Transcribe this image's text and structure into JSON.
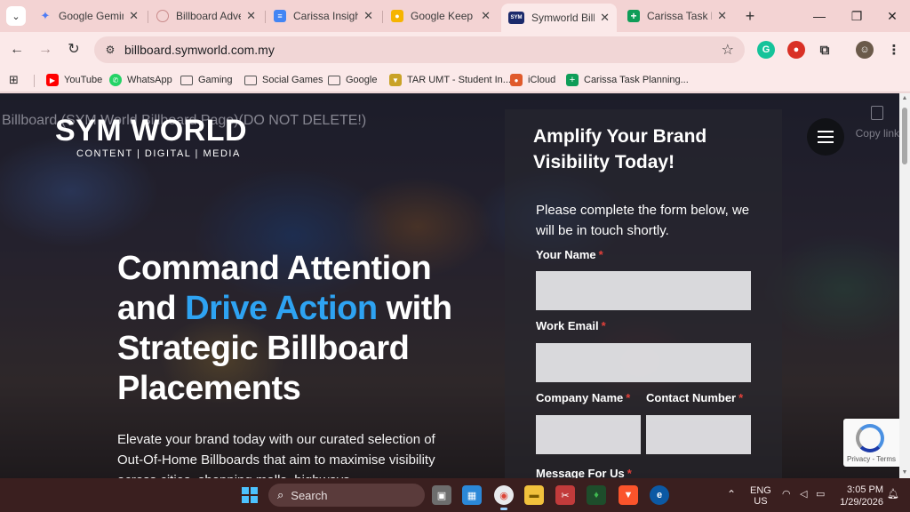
{
  "browser": {
    "tabs": [
      {
        "title": "Google Gemini",
        "favicon": "gemini-icon",
        "color": "#4e7cf5",
        "glyph": "✦"
      },
      {
        "title": "Billboard Advert",
        "favicon": "billboard-icon",
        "color": "#c98a8a",
        "glyph": "◉"
      },
      {
        "title": "Carissa Insight E",
        "favicon": "docs-icon",
        "color": "#4285f4",
        "glyph": "≡"
      },
      {
        "title": "Google Keep",
        "favicon": "keep-icon",
        "color": "#f6b400",
        "glyph": "●"
      },
      {
        "title": "Symworld Billbo",
        "favicon": "symworld-icon",
        "color": "#1b2a6b",
        "glyph": "SYM",
        "active": true
      },
      {
        "title": "Carissa Task Plan",
        "favicon": "sheets-icon",
        "color": "#0f9d58",
        "glyph": "+"
      }
    ],
    "address": {
      "url": "billboard.symworld.com.my"
    },
    "bookmarks": [
      {
        "label": "YouTube",
        "icon": "youtube-icon",
        "color": "#ff0000"
      },
      {
        "label": "WhatsApp",
        "icon": "whatsapp-icon",
        "color": "#25d366"
      },
      {
        "label": "Gaming",
        "icon": "folder-icon"
      },
      {
        "label": "Social Games",
        "icon": "folder-icon"
      },
      {
        "label": "Google",
        "icon": "folder-icon"
      },
      {
        "label": "TAR UMT - Student In...",
        "icon": "tarumt-icon",
        "color": "#c9a227"
      },
      {
        "label": "iCloud",
        "icon": "icloud-icon",
        "color": "#e05a2b"
      },
      {
        "label": "Carissa Task Planning...",
        "icon": "sheets-icon",
        "color": "#0f9d58"
      }
    ]
  },
  "page": {
    "doc_title": "Billboard (SYM World Billboard Page)(DO NOT DELETE!)",
    "logo_main": "SYM WORLD",
    "logo_sub": "CONTENT | DIGITAL | MEDIA",
    "hero": {
      "line1": "Command Attention",
      "line2a": "and ",
      "line2_accent": "Drive Action",
      "line2b": " with",
      "line3": "Strategic Billboard",
      "line4": "Placements",
      "accent_color": "#2ea3f2"
    },
    "description": "Elevate your brand today with our curated selection of Out-Of-Home Billboards that aim to maximise visibility across cities, shopping malls, highways",
    "copy_link": "Copy link",
    "form": {
      "title": "Amplify Your Brand Visibility Today!",
      "intro": "Please complete the form below, we will be in touch shortly.",
      "required_mark": "*",
      "fields": {
        "name": "Your Name",
        "email": "Work Email",
        "company": "Company Name",
        "contact": "Contact Number",
        "message": "Message For Us"
      }
    },
    "recaptcha_links": "Privacy - Terms"
  },
  "taskbar": {
    "search": "Search",
    "lang1": "ENG",
    "lang2": "US",
    "time": "3:05 PM",
    "date": "1/29/2026"
  }
}
